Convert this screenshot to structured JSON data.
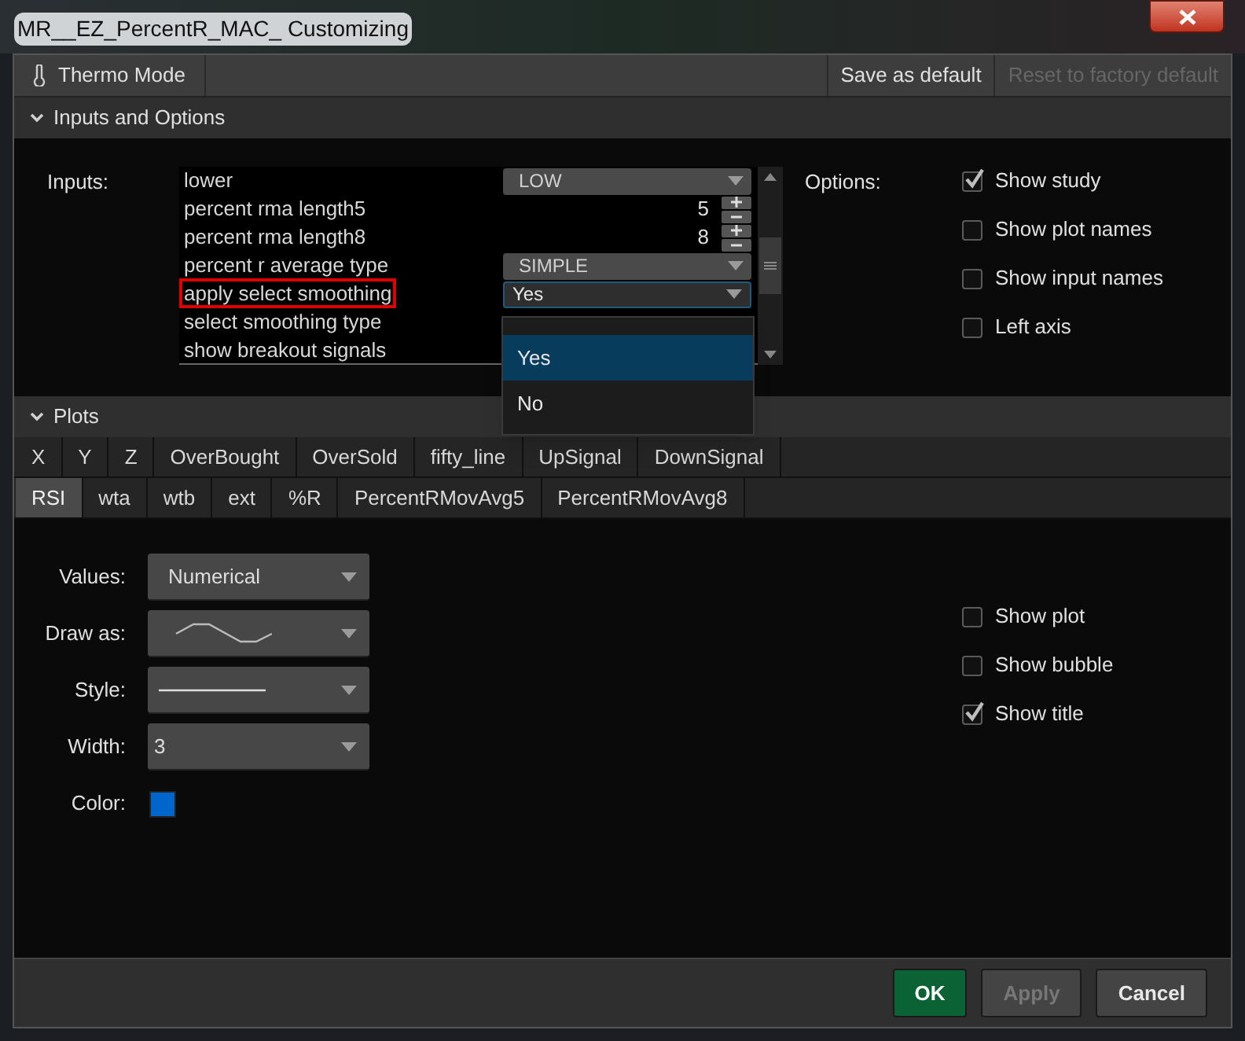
{
  "window": {
    "title": "MR__EZ_PercentR_MAC_ Customizing"
  },
  "toolbar": {
    "thermo_mode": "Thermo Mode",
    "save_default": {
      "label": "Save as default",
      "disabled": false
    },
    "reset_default": {
      "label": "Reset to factory default",
      "disabled": true
    }
  },
  "inputs_section": {
    "title": "Inputs and Options",
    "expanded": true,
    "inputs_label": "Inputs:",
    "inputs": [
      {
        "name": "lower",
        "kind": "dropdown",
        "value": "LOW",
        "highlighted": false,
        "focused": false
      },
      {
        "name": "percent rma length5",
        "kind": "number",
        "value": "5",
        "highlighted": false
      },
      {
        "name": "percent rma length8",
        "kind": "number",
        "value": "8",
        "highlighted": false
      },
      {
        "name": "percent r average type",
        "kind": "dropdown",
        "value": "SIMPLE",
        "highlighted": false,
        "focused": false
      },
      {
        "name": "apply select smoothing",
        "kind": "dropdown",
        "value": "Yes",
        "highlighted": true,
        "focused": true
      },
      {
        "name": "select smoothing type",
        "kind": "hidden",
        "highlighted": false
      },
      {
        "name": "show breakout signals",
        "kind": "hidden",
        "highlighted": false
      }
    ],
    "dropdown_options": [
      {
        "label": "Yes",
        "selected": true
      },
      {
        "label": "No",
        "selected": false
      }
    ],
    "options_label": "Options:",
    "options": [
      {
        "label": "Show study",
        "checked": true
      },
      {
        "label": "Show plot names",
        "checked": false
      },
      {
        "label": "Show input names",
        "checked": false
      },
      {
        "label": "Left axis",
        "checked": false
      }
    ]
  },
  "plots_section": {
    "title": "Plots",
    "expanded": true,
    "tab_rows": [
      [
        {
          "label": "X",
          "selected": false
        },
        {
          "label": "Y",
          "selected": false
        },
        {
          "label": "Z",
          "selected": false
        },
        {
          "label": "OverBought",
          "selected": false
        },
        {
          "label": "OverSold",
          "selected": false
        },
        {
          "label": "fifty_line",
          "selected": false
        },
        {
          "label": "UpSignal",
          "selected": false
        },
        {
          "label": "DownSignal",
          "selected": false
        }
      ],
      [
        {
          "label": "RSI",
          "selected": true
        },
        {
          "label": "wta",
          "selected": false
        },
        {
          "label": "wtb",
          "selected": false
        },
        {
          "label": "ext",
          "selected": false
        },
        {
          "label": "%R",
          "selected": false
        },
        {
          "label": "PercentRMovAvg5",
          "selected": false
        },
        {
          "label": "PercentRMovAvg8",
          "selected": false
        }
      ]
    ],
    "settings": [
      {
        "label": "Values:",
        "kind": "text",
        "value": "Numerical"
      },
      {
        "label": "Draw as:",
        "kind": "draw"
      },
      {
        "label": "Style:",
        "kind": "style"
      },
      {
        "label": "Width:",
        "kind": "text",
        "value": "3"
      },
      {
        "label": "Color:",
        "kind": "color",
        "color": "#0066cc"
      }
    ],
    "checks": [
      {
        "label": "Show plot",
        "checked": false
      },
      {
        "label": "Show bubble",
        "checked": false
      },
      {
        "label": "Show title",
        "checked": true
      }
    ]
  },
  "buttons": [
    {
      "label": "OK",
      "kind": "primary",
      "disabled": false
    },
    {
      "label": "Apply",
      "kind": "normal",
      "disabled": true
    },
    {
      "label": "Cancel",
      "kind": "normal",
      "disabled": false
    }
  ]
}
